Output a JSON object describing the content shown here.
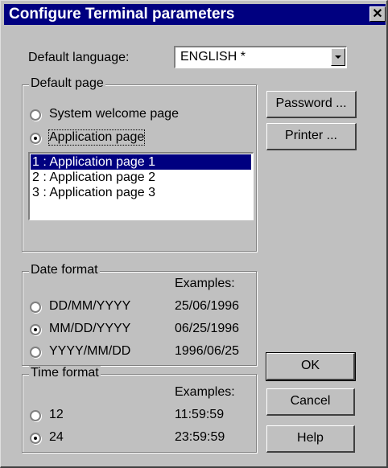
{
  "window": {
    "title": "Configure Terminal parameters",
    "close_glyph": "✕"
  },
  "language": {
    "label": "Default language:",
    "value": "ENGLISH *"
  },
  "default_page": {
    "title": "Default page",
    "options": [
      "System welcome page",
      "Application page"
    ],
    "selected": 1,
    "list": [
      "1 : Application page 1",
      "2 : Application page 2",
      "3 : Application page 3"
    ],
    "list_selected": 0
  },
  "date_format": {
    "title": "Date format",
    "examples_label": "Examples:",
    "options": [
      {
        "label": "DD/MM/YYYY",
        "example": "25/06/1996"
      },
      {
        "label": "MM/DD/YYYY",
        "example": "06/25/1996"
      },
      {
        "label": "YYYY/MM/DD",
        "example": "1996/06/25"
      }
    ],
    "selected": 1
  },
  "time_format": {
    "title": "Time format",
    "examples_label": "Examples:",
    "options": [
      {
        "label": "12",
        "example": "11:59:59"
      },
      {
        "label": "24",
        "example": "23:59:59"
      }
    ],
    "selected": 1
  },
  "buttons": {
    "password": "Password ...",
    "printer": "Printer ...",
    "ok": "OK",
    "cancel": "Cancel",
    "help": "Help"
  }
}
